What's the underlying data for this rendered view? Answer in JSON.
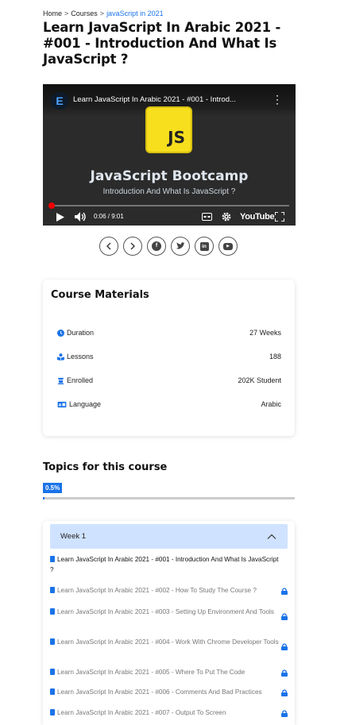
{
  "breadcrumb": {
    "items": [
      {
        "label": "Home"
      },
      {
        "label": "Courses"
      },
      {
        "label": "javaScript in 2021"
      }
    ],
    "separator": ">"
  },
  "page_title": "Learn JavaScript In Arabic 2021 - #001 - Introduction And What Is JavaScript ?",
  "video": {
    "channel_logo": "E",
    "title": "Learn JavaScript In Arabic 2021 - #001 - Introd...",
    "js_badge": "JS",
    "heading": "JavaScript Bootcamp",
    "subheading": "Introduction And What Is JavaScript ?",
    "time": "0:06 / 9:01",
    "progress": 0.011,
    "brand": "YouTube"
  },
  "share_buttons": [
    {
      "name": "prev-button",
      "icon": "chevron-left-icon"
    },
    {
      "name": "next-button",
      "icon": "chevron-right-icon"
    },
    {
      "name": "facebook-share-button",
      "icon": "facebook-icon"
    },
    {
      "name": "twitter-share-button",
      "icon": "twitter-icon"
    },
    {
      "name": "linkedin-share-button",
      "icon": "linkedin-icon"
    },
    {
      "name": "youtube-share-button",
      "icon": "youtube-icon"
    }
  ],
  "materials": {
    "title": "Course Materials",
    "rows": [
      {
        "label": "Duration",
        "value": "27 Weeks",
        "icon": "clock-icon"
      },
      {
        "label": "Lessons",
        "value": "188",
        "icon": "lessons-icon"
      },
      {
        "label": "Enrolled",
        "value": "202K Student",
        "icon": "graduation-cap-icon"
      },
      {
        "label": "Language",
        "value": "Arabic",
        "icon": "language-icon"
      }
    ]
  },
  "topics": {
    "title": "Topics for this course",
    "percent_label": "0.5%",
    "percent": 0.005
  },
  "week": {
    "label": "Week 1",
    "lessons": [
      {
        "title": "Learn JavaScript In Arabic 2021 - #001 - Introduction And What Is JavaScript ?",
        "locked": false
      },
      {
        "title": "Learn JavaScript In Arabic 2021 - #002 - How To Study The Course ?",
        "locked": true
      },
      {
        "title": "Learn JavaScript In Arabic 2021 - #003 - Setting Up Environment And Tools",
        "locked": true
      },
      {
        "title": "Learn JavaScript In Arabic 2021 - #004 - Work With Chrome Developer Tools",
        "locked": true
      },
      {
        "title": "Learn JavaScript In Arabic 2021 - #005 - Where To Put The Code",
        "locked": true
      },
      {
        "title": "Learn JavaScript In Arabic 2021 - #006 - Comments And Bad Practices",
        "locked": true
      },
      {
        "title": "Learn JavaScript In Arabic 2021 - #007 - Output To Screen",
        "locked": true
      }
    ]
  },
  "colors": {
    "accent": "#1a73e8",
    "week_header_bg": "#cfe2ff",
    "video_progress": "#ee0000",
    "js_yellow": "#f7df1e"
  }
}
